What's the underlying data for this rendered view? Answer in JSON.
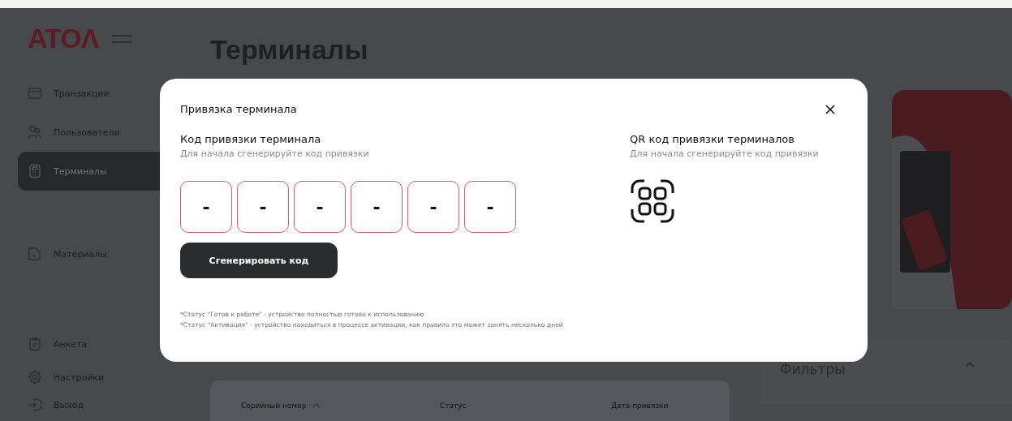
{
  "sidebar": {
    "logo": "ATOΛ",
    "sections": [
      [
        {
          "label": "Транзакции",
          "selected": false
        },
        {
          "label": "Пользователи",
          "selected": false
        },
        {
          "label": "Терминалы",
          "selected": true
        }
      ],
      [
        {
          "label": "Материалы",
          "selected": false
        }
      ],
      [
        {
          "label": "Анкета",
          "selected": false
        },
        {
          "label": "Настройки",
          "selected": false
        },
        {
          "label": "Выход",
          "selected": false
        }
      ]
    ]
  },
  "page": {
    "title": "Терминалы",
    "table": {
      "columns": [
        {
          "label": "Серийный номер",
          "sorted": true
        },
        {
          "label": "Статус",
          "sorted": false
        },
        {
          "label": "Дата привязки",
          "sorted": false
        }
      ]
    },
    "filters": {
      "title": "Фильтры",
      "expanded": true
    }
  },
  "modal": {
    "title": "Привязка терминала",
    "code": {
      "title": "Код привязки терминала",
      "hint": "Для начала сгенерируйте код привязки",
      "cells": [
        "-",
        "-",
        "-",
        "-",
        "-",
        "-"
      ],
      "button": "Сгенерировать код"
    },
    "qr": {
      "title": "QR код привязки терминалов",
      "hint": "Для начала сгенерируйте код привязки"
    },
    "notes": [
      "*Статус \"Готов к работе\" - устройство полностью готово к использованию",
      "*Статус \"Активация\" - устройство находиться в процессе активации, как правило это может занять несколько дней"
    ]
  }
}
